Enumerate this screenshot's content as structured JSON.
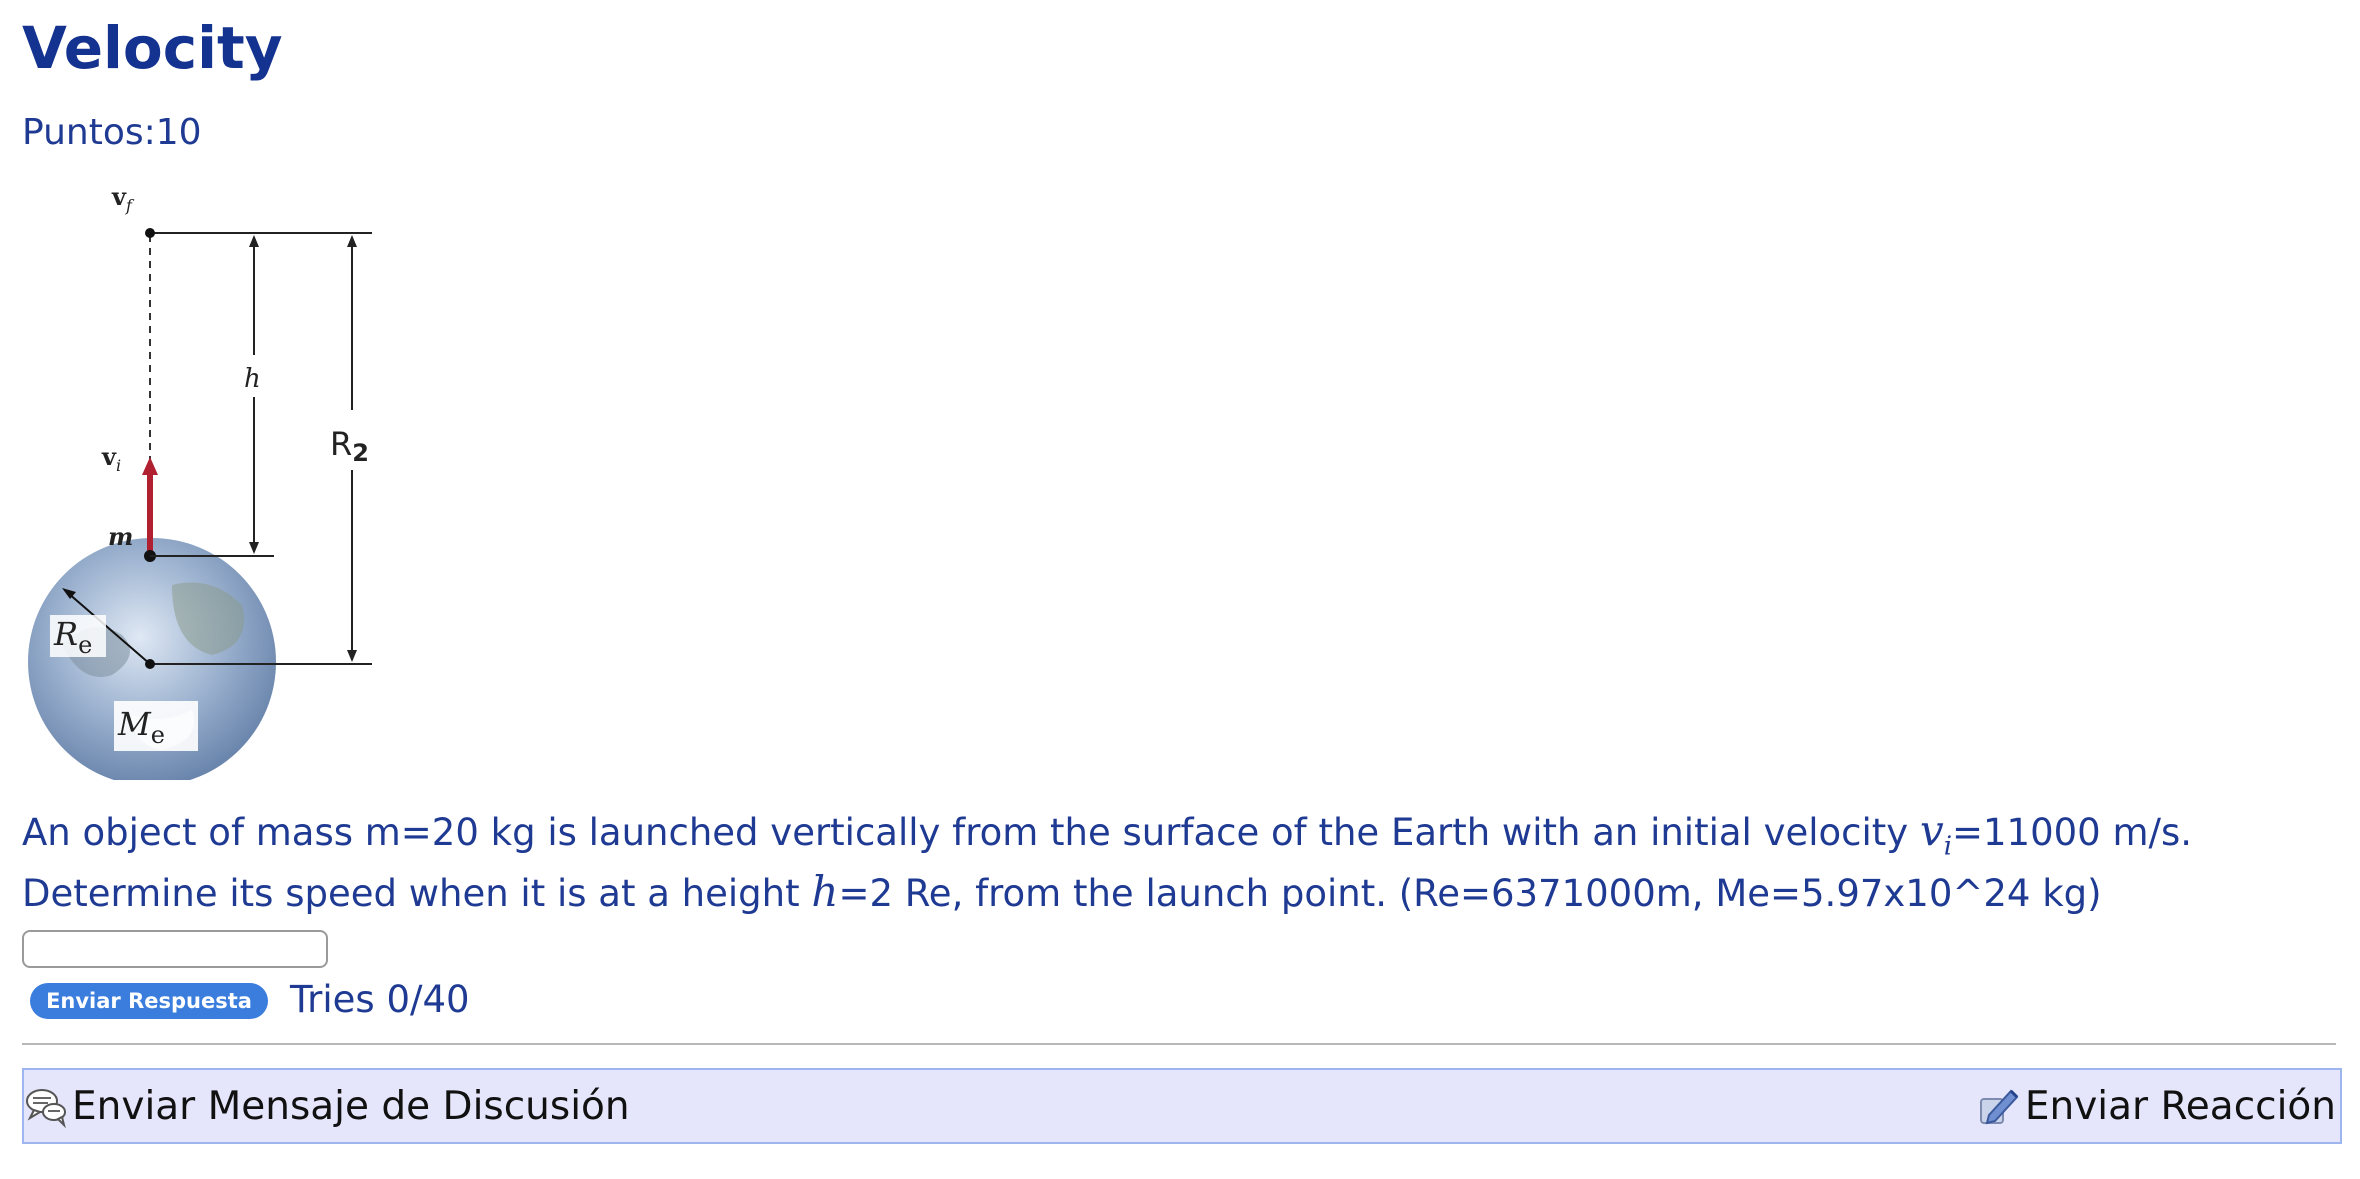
{
  "problem": {
    "title": "Velocity",
    "points": "Puntos:10",
    "question": {
      "line1_before": "An object of mass m=20 kg is launched vertically from the surface of the Earth with an initial velocity ",
      "vi_symbol": "v",
      "vi_subscript": "i",
      "line1_after": "=11000 m/s.",
      "line2_before": "Determine its speed when it is at a height ",
      "h_symbol": "h",
      "line2_after": "=2 Re, from the launch point. (Re=6371000m, Me=5.97x10^24 kg)"
    },
    "figure_labels": {
      "vf": "v",
      "vf_sub": "f",
      "vi": "v",
      "vi_sub": "i",
      "m": "m",
      "h": "h",
      "R2": "R",
      "R2_sub": "2",
      "Re": "R",
      "Re_sub": "e",
      "Me": "M",
      "Me_sub": "e"
    },
    "answer": {
      "value": "",
      "placeholder": ""
    },
    "submit_label": "Enviar Respuesta",
    "tries": "Tries 0/40"
  },
  "discussion": {
    "send_message_label": "Enviar Mensaje de Discusión",
    "send_reaction_label": "Enviar Reacción",
    "icons": [
      "discussion-bubble-icon",
      "reaction-pencil-icon"
    ]
  },
  "colors": {
    "title": "#14328f",
    "text": "#1f3a93",
    "button": "#3b7ddd",
    "bar_background": "#e5e6fb",
    "bar_border": "#9eb6ef",
    "arrow_red": "#b02030"
  }
}
